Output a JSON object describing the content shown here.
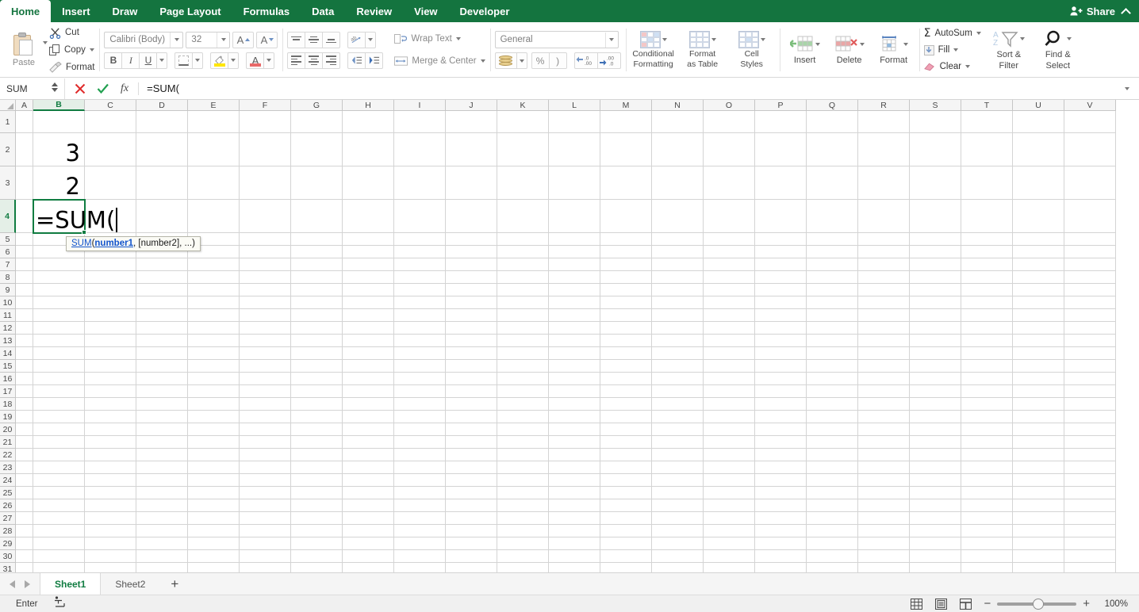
{
  "ribbon": {
    "tabs": [
      {
        "label": "Home",
        "active": true
      },
      {
        "label": "Insert",
        "active": false
      },
      {
        "label": "Draw",
        "active": false
      },
      {
        "label": "Page Layout",
        "active": false
      },
      {
        "label": "Formulas",
        "active": false
      },
      {
        "label": "Data",
        "active": false
      },
      {
        "label": "Review",
        "active": false
      },
      {
        "label": "View",
        "active": false
      },
      {
        "label": "Developer",
        "active": false
      }
    ],
    "share_label": "Share",
    "clipboard": {
      "paste_label": "Paste",
      "cut_label": "Cut",
      "copy_label": "Copy",
      "format_painter_label": "Format"
    },
    "font": {
      "font_name": "Calibri (Body)",
      "font_size": "32",
      "bold_label": "B",
      "italic_label": "I",
      "underline_label": "U",
      "grow_font_label": "A",
      "shrink_font_label": "A",
      "fill_color": "#ffe600",
      "font_color": "#e96a6a"
    },
    "alignment": {
      "wrap_text_label": "Wrap Text",
      "merge_center_label": "Merge & Center"
    },
    "number": {
      "format": "General",
      "percent_label": "%",
      "comma_label": ")"
    },
    "styles": {
      "conditional_formatting_label": "Conditional\nFormatting",
      "conditional_formatting_line1": "Conditional",
      "conditional_formatting_line2": "Formatting",
      "format_as_table_line1": "Format",
      "format_as_table_line2": "as Table",
      "cell_styles_line1": "Cell",
      "cell_styles_line2": "Styles"
    },
    "cells": {
      "insert_label": "Insert",
      "delete_label": "Delete",
      "format_label": "Format"
    },
    "editing": {
      "autosum_label": "AutoSum",
      "autosum_glyph": "Σ",
      "fill_label": "Fill",
      "clear_label": "Clear",
      "sort_filter_line1": "Sort &",
      "sort_filter_line2": "Filter",
      "find_select_line1": "Find &",
      "find_select_line2": "Select"
    }
  },
  "formula_bar": {
    "name_box": "SUM",
    "cancel_icon": "cancel-icon",
    "confirm_icon": "confirm-icon",
    "fx_label": "fx",
    "formula": "=SUM("
  },
  "grid": {
    "columns": [
      "A",
      "B",
      "C",
      "D",
      "E",
      "F",
      "G",
      "H",
      "I",
      "J",
      "K",
      "L",
      "M",
      "N",
      "O",
      "P",
      "Q",
      "R",
      "S",
      "T",
      "U",
      "V"
    ],
    "selected_column": "B",
    "rows": [
      1,
      2,
      3,
      4,
      5,
      6,
      7,
      8,
      9,
      10,
      11,
      12,
      13,
      14,
      15,
      16,
      17,
      18,
      19,
      20,
      21,
      22,
      23,
      24,
      25,
      26,
      27,
      28,
      29,
      30,
      31
    ],
    "selected_row": 4,
    "cell_values": [
      {
        "ref": "B2",
        "row": 2,
        "col": "B",
        "value": "3"
      },
      {
        "ref": "B3",
        "row": 3,
        "col": "B",
        "value": "2"
      }
    ],
    "active_cell": {
      "ref": "B4",
      "row": 4,
      "col": "B",
      "editing_text": "=SUM("
    },
    "tooltip": {
      "function_name": "SUM",
      "open_paren": "(",
      "first_arg": "number1",
      "rest": ", [number2], ...)"
    }
  },
  "sheet_tabs": {
    "sheets": [
      {
        "label": "Sheet1",
        "active": true
      },
      {
        "label": "Sheet2",
        "active": false
      }
    ],
    "add_sheet_label": "+"
  },
  "status_bar": {
    "mode": "Enter",
    "accessibility_icon": "accessibility-icon",
    "view_normal_icon": "normal-view-icon",
    "view_page_layout_icon": "page-layout-view-icon",
    "view_page_break_icon": "page-break-view-icon",
    "zoom_out_label": "−",
    "zoom_in_label": "+",
    "zoom_level": "100%"
  }
}
